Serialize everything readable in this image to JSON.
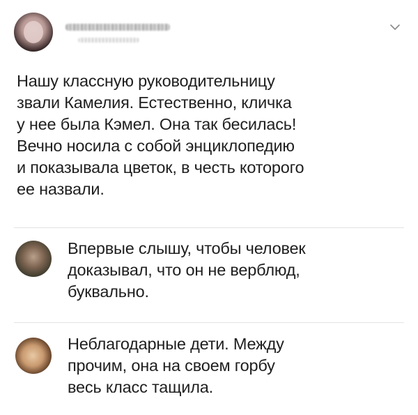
{
  "post": {
    "author_name": "",
    "text_lines": [
      "Нашу классную руководительницу",
      "звали Камелия. Естественно, кличка",
      "у нее была Кэмел. Она так бесилась!",
      "Вечно носила с собой энциклопедию",
      "и показывала цветок, в честь которого",
      "ее назвали."
    ]
  },
  "replies": [
    {
      "text_lines": [
        "Впервые слышу, чтобы человек",
        "доказывал, что он не верблюд,",
        "буквально."
      ]
    },
    {
      "text_lines": [
        "Неблагодарные дети. Между",
        "прочим, она на своем горбу",
        "весь класс тащила."
      ]
    }
  ],
  "icons": {
    "menu": "chevron-down-icon"
  },
  "colors": {
    "text": "#1f1f1f",
    "divider": "#e3e3e3",
    "icon": "#8a8a8a"
  }
}
